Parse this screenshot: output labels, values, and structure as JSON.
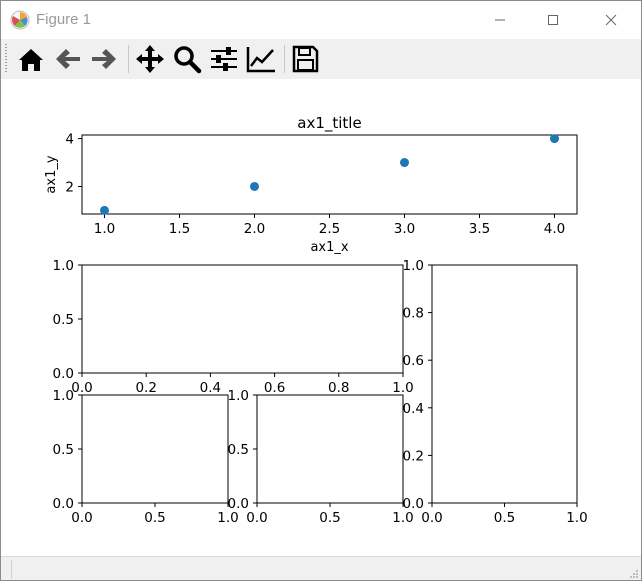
{
  "window": {
    "title": "Figure 1",
    "controls": {
      "minimize": "minimize-icon",
      "maximize": "maximize-icon",
      "close": "close-icon"
    }
  },
  "toolbar": {
    "buttons": [
      {
        "name": "home-button",
        "icon": "home-icon"
      },
      {
        "name": "back-button",
        "icon": "arrow-left-icon"
      },
      {
        "name": "forward-button",
        "icon": "arrow-right-icon"
      },
      {
        "name": "pan-button",
        "icon": "move-icon"
      },
      {
        "name": "zoom-button",
        "icon": "magnifier-icon"
      },
      {
        "name": "configure-subplots-button",
        "icon": "sliders-icon"
      },
      {
        "name": "edit-axes-button",
        "icon": "line-chart-icon"
      },
      {
        "name": "save-button",
        "icon": "floppy-disk-icon"
      }
    ]
  },
  "colors": {
    "marker": "#1f77b4",
    "axes": "#000000",
    "toolbar_bg": "#f0f0f0"
  },
  "chart_data": [
    {
      "type": "scatter",
      "title": "ax1_title",
      "xlabel": "ax1_x",
      "ylabel": "ax1_y",
      "x": [
        1,
        2,
        3,
        4
      ],
      "y": [
        1,
        2,
        3,
        4
      ],
      "xticks": [
        "1.0",
        "1.5",
        "2.0",
        "2.5",
        "3.0",
        "3.5",
        "4.0"
      ],
      "yticks": [
        "2",
        "4"
      ],
      "xlim": [
        0.85,
        4.15
      ],
      "ylim": [
        0.85,
        4.15
      ],
      "grid": false
    },
    {
      "type": "empty",
      "xticks": [
        "0.0",
        "0.2",
        "0.4",
        "0.6",
        "0.8",
        "1.0"
      ],
      "yticks": [
        "0.0",
        "0.5",
        "1.0"
      ],
      "xlim": [
        0,
        1
      ],
      "ylim": [
        0,
        1
      ]
    },
    {
      "type": "empty",
      "xticks": [
        "0.0",
        "0.5",
        "1.0"
      ],
      "yticks": [
        "0.0",
        "0.5",
        "1.0"
      ],
      "xlim": [
        0,
        1
      ],
      "ylim": [
        0,
        1
      ]
    },
    {
      "type": "empty",
      "xticks": [
        "0.0",
        "0.5",
        "1.0"
      ],
      "yticks": [
        "0.0",
        "0.5",
        "1.0"
      ],
      "xlim": [
        0,
        1
      ],
      "ylim": [
        0,
        1
      ]
    },
    {
      "type": "empty",
      "xticks": [
        "0.0",
        "0.5",
        "1.0"
      ],
      "yticks": [
        "0.0",
        "0.2",
        "0.4",
        "0.6",
        "0.8",
        "1.0"
      ],
      "xlim": [
        0,
        1
      ],
      "ylim": [
        0,
        1
      ]
    }
  ]
}
